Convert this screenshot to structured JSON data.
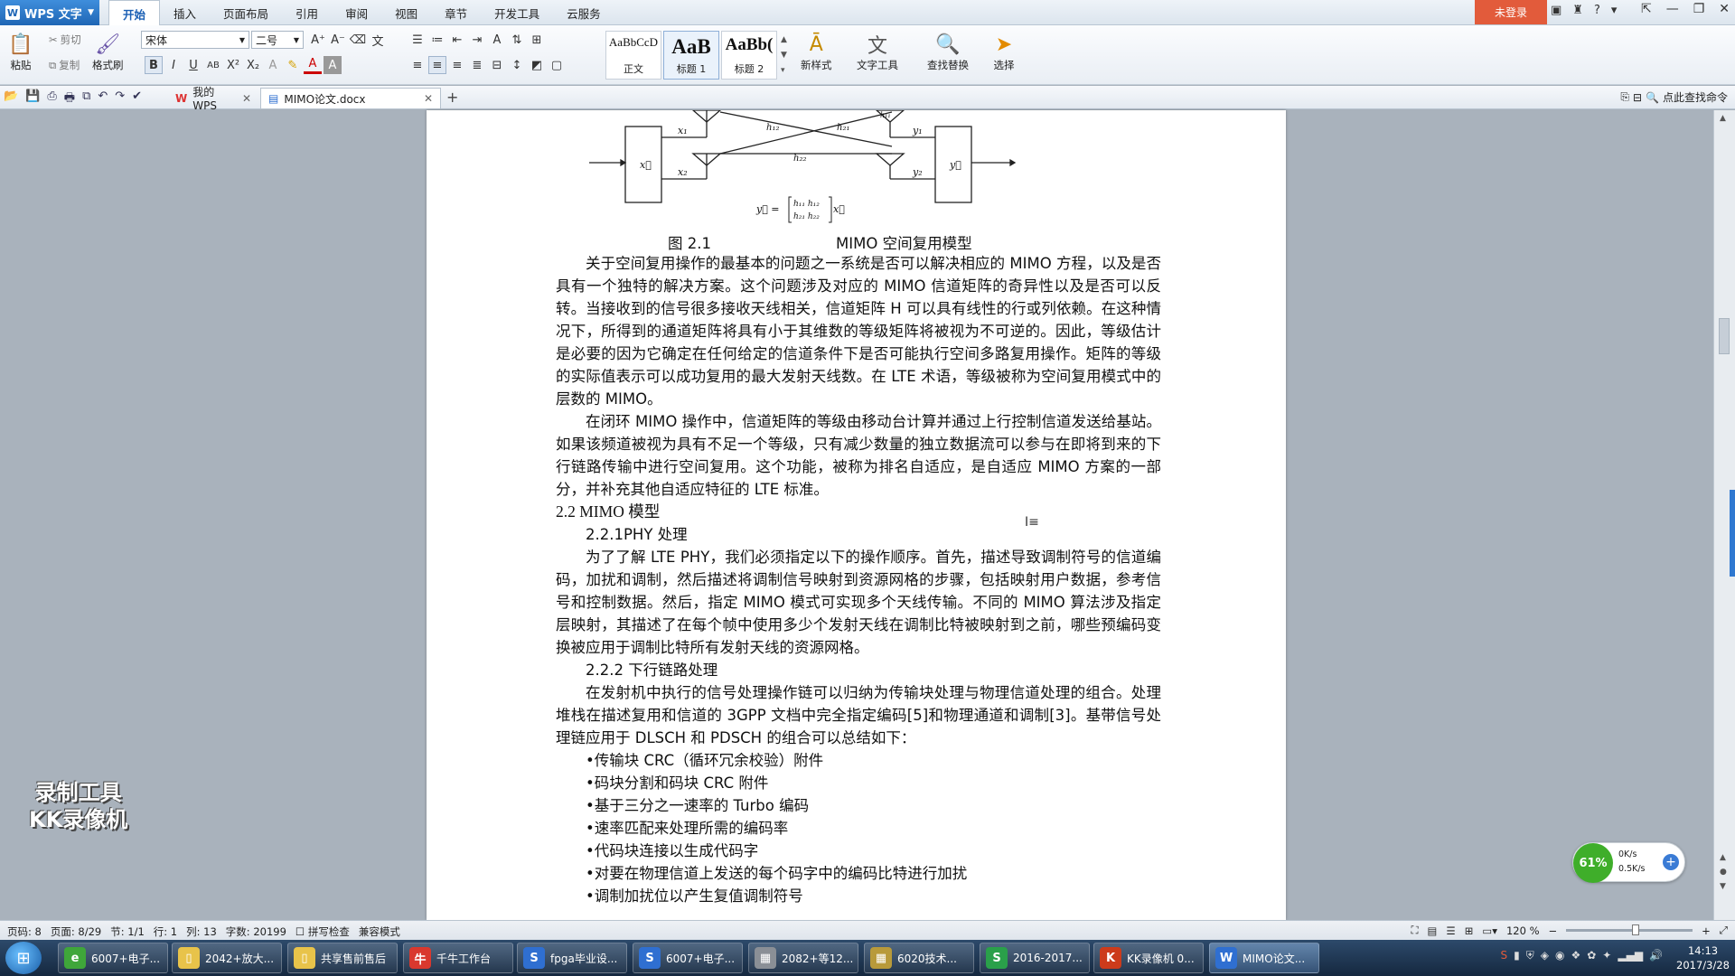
{
  "app": {
    "name": "WPS 文字",
    "login_label": "未登录"
  },
  "menu_tabs": [
    "开始",
    "插入",
    "页面布局",
    "引用",
    "审阅",
    "视图",
    "章节",
    "开发工具",
    "云服务"
  ],
  "ribbon": {
    "paste": "粘贴",
    "cut": "剪切",
    "copy": "复制",
    "format_painter": "格式刷",
    "font_name": "宋体",
    "font_size": "二号",
    "styles": [
      {
        "sample": "AaBbCcD",
        "name": "正文"
      },
      {
        "sample": "AaB",
        "name": "标题 1"
      },
      {
        "sample": "AaBb(",
        "name": "标题 2"
      }
    ],
    "new_style": "新样式",
    "text_tools": "文字工具",
    "find_replace": "查找替换",
    "select": "选择"
  },
  "doc_tabs": [
    {
      "label": "我的WPS"
    },
    {
      "label": "MIMO论文.docx"
    }
  ],
  "command_search": "点此查找命令",
  "document": {
    "figure": {
      "x1": "x₁",
      "x2": "x₂",
      "y1": "y₁",
      "y2": "y₂",
      "h11": "h₁₁",
      "h12": "h₁₂",
      "h21": "h₂₁",
      "h22": "h₂₂",
      "tx": "x⃗",
      "rx": "y⃗",
      "equation_left": "y⃗ =",
      "matrix_r1": "h₁₁  h₁₂",
      "matrix_r2": "h₂₁  h₂₂",
      "equation_right": "x⃗"
    },
    "caption_num": "图 2.1",
    "caption_title": "MIMO 空间复用模型",
    "para1": "关于空间复用操作的最基本的问题之一系统是否可以解决相应的 MIMO 方程，以及是否具有一个独特的解决方案。这个问题涉及对应的 MIMO 信道矩阵的奇异性以及是否可以反转。当接收到的信号很多接收天线相关，信道矩阵 H 可以具有线性的行或列依赖。在这种情况下，所得到的通道矩阵将具有小于其维数的等级矩阵将被视为不可逆的。因此，等级估计是必要的因为它确定在任何给定的信道条件下是否可能执行空间多路复用操作。矩阵的等级的实际值表示可以成功复用的最大发射天线数。在 LTE 术语，等级被称为空间复用模式中的层数的 MIMO。",
    "para2": "在闭环 MIMO 操作中，信道矩阵的等级由移动台计算并通过上行控制信道发送给基站。如果该频道被视为具有不足一个等级，只有减少数量的独立数据流可以参与在即将到来的下行链路传输中进行空间复用。这个功能，被称为排名自适应，是自适应 MIMO 方案的一部分，并补充其他自适应特征的 LTE 标准。",
    "h2": "2.2 MIMO 模型",
    "h3_1": "2.2.1PHY 处理",
    "para3": "为了了解 LTE PHY，我们必须指定以下的操作顺序。首先，描述导致调制符号的信道编码，加扰和调制，然后描述将调制信号映射到资源网格的步骤，包括映射用户数据，参考信号和控制数据。然后，指定 MIMO 模式可实现多个天线传输。不同的 MIMO 算法涉及指定层映射，其描述了在每个帧中使用多少个发射天线在调制比特被映射到之前，哪些预编码变换被应用于调制比特所有发射天线的资源网格。",
    "h3_2": "2.2.2 下行链路处理",
    "para4": "在发射机中执行的信号处理操作链可以归纳为传输块处理与物理信道处理的组合。处理堆栈在描述复用和信道的 3GPP 文档中完全指定编码[5]和物理通道和调制[3]。基带信号处理链应用于 DLSCH 和 PDSCH 的组合可以总结如下：",
    "bullets": [
      "•传输块 CRC（循环冗余校验）附件",
      "•码块分割和码块 CRC 附件",
      "•基于三分之一速率的 Turbo 编码",
      "•速率匹配来处理所需的编码率",
      "•代码块连接以生成代码字",
      "•对要在物理信道上发送的每个码字中的编码比特进行加扰",
      "•调制加扰位以产生复值调制符号"
    ]
  },
  "watermark": {
    "line1": "录制工具",
    "line2": "KK录像机"
  },
  "net_widget": {
    "percent": "61%",
    "up": "0K/s",
    "down": "0.5K/s"
  },
  "status": {
    "page": "页码: 8",
    "pages": "页面: 8/29",
    "section": "节: 1/1",
    "row": "行: 1",
    "col": "列: 13",
    "words": "字数: 20199",
    "spell": "拼写检查",
    "compat": "兼容模式",
    "zoom": "120 %",
    "zoom_level": 0.55
  },
  "taskbar": [
    {
      "label": "6007+电子...",
      "icon": "360-icon",
      "color": "#3fa63a",
      "glyph": "e"
    },
    {
      "label": "2042+放大...",
      "icon": "folder-icon",
      "color": "#e8c34a",
      "glyph": "▯"
    },
    {
      "label": "共享售前售后",
      "icon": "folder-icon",
      "color": "#e8c34a",
      "glyph": "▯"
    },
    {
      "label": "千牛工作台",
      "icon": "qianniu-icon",
      "color": "#d9382e",
      "glyph": "牛"
    },
    {
      "label": "fpga毕业设...",
      "icon": "sogou-icon",
      "color": "#2f6fd1",
      "glyph": "S"
    },
    {
      "label": "6007+电子...",
      "icon": "sogou-icon",
      "color": "#2f6fd1",
      "glyph": "S"
    },
    {
      "label": "2082+等12...",
      "icon": "image-icon",
      "color": "#8a8f96",
      "glyph": "▦"
    },
    {
      "label": "6020技术...",
      "icon": "image-icon",
      "color": "#b89a3a",
      "glyph": "▦"
    },
    {
      "label": "2016-2017...",
      "icon": "wps-sheet-icon",
      "color": "#2aa04a",
      "glyph": "S"
    },
    {
      "label": "KK录像机 0...",
      "icon": "kk-icon",
      "color": "#cc3b1b",
      "glyph": "K"
    },
    {
      "label": "MIMO论文...",
      "icon": "wps-writer-icon",
      "color": "#2f6fd1",
      "glyph": "W"
    }
  ],
  "clock": {
    "time": "14:13",
    "date": "2017/3/28"
  }
}
